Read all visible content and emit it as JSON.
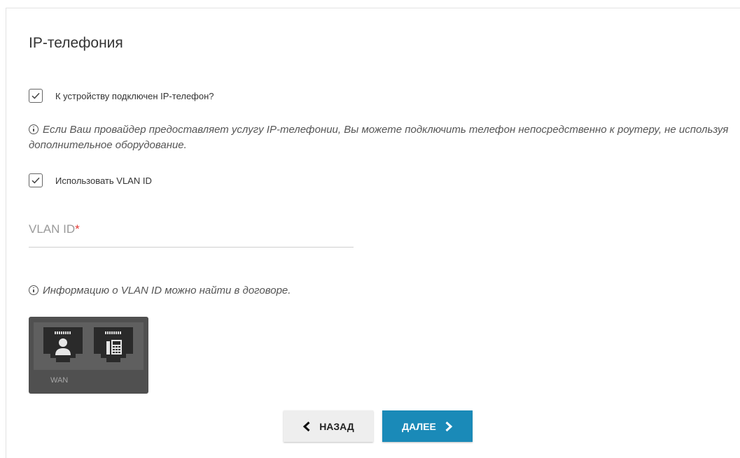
{
  "page": {
    "title": "IP-телефония"
  },
  "phone_connected": {
    "checked": true,
    "label": "К устройству подключен IP-телефон?"
  },
  "info1": {
    "text": "Если Ваш провайдер предоставляет услугу IP-телефонии, Вы можете подключить телефон непосредственно к роутеру, не используя дополнительное оборудование."
  },
  "use_vlan": {
    "checked": true,
    "label": "Использовать VLAN ID"
  },
  "vlan_field": {
    "label": "VLAN ID",
    "required_mark": "*",
    "value": ""
  },
  "info2": {
    "text": "Информацию о VLAN ID можно найти в договоре."
  },
  "device": {
    "port_label": "WAN",
    "ports": [
      {
        "icon": "user-icon"
      },
      {
        "icon": "phone-icon"
      }
    ]
  },
  "buttons": {
    "back": "НАЗАД",
    "next": "ДАЛЕЕ"
  },
  "colors": {
    "accent": "#1a8ab8",
    "required": "#e53935",
    "device": "#505050"
  }
}
